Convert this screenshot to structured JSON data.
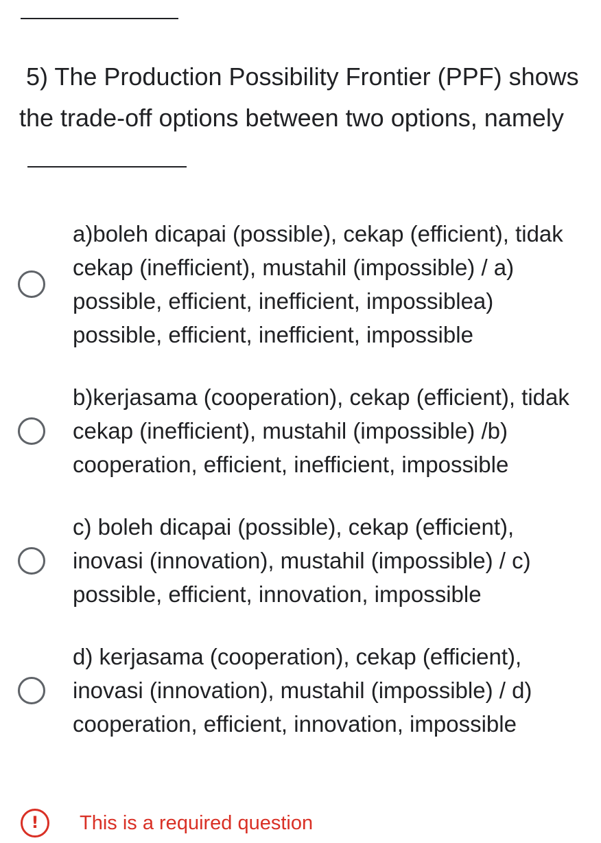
{
  "question": {
    "number_label": "5)",
    "text": "The Production Possibility Frontier (PPF) shows the trade-off options between two options, namely"
  },
  "options": [
    {
      "label": "a)boleh dicapai (possible), cekap (efficient), tidak cekap (inefficient), mustahil (impossible) / a) possible, efficient, inefficient, impossiblea) possible, efficient, inefficient, impossible"
    },
    {
      "label": "b)kerjasama (cooperation), cekap (efficient), tidak cekap (inefficient), mustahil (impossible) /b) cooperation, efficient, inefficient, impossible"
    },
    {
      "label": "c) boleh dicapai (possible), cekap (efficient), inovasi (innovation), mustahil (impossible) / c) possible, efficient, innovation, impossible"
    },
    {
      "label": "d) kerjasama (cooperation), cekap (efficient), inovasi (innovation), mustahil (impossible) / d) cooperation, efficient, innovation, impossible"
    }
  ],
  "validation": {
    "icon": "exclamation-circle-icon",
    "message": "This is a required question"
  },
  "colors": {
    "text": "#202124",
    "radio_border": "#5f6368",
    "error": "#d93025"
  }
}
